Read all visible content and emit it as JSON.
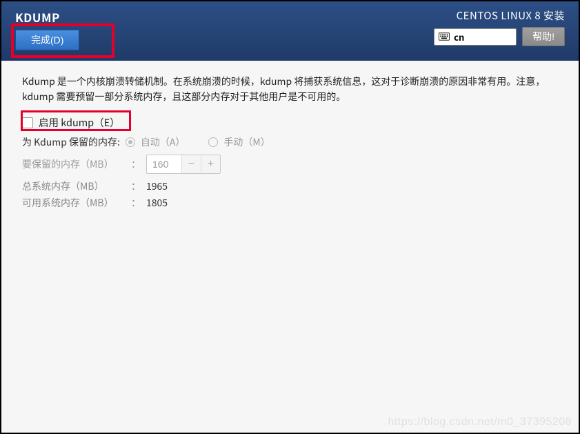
{
  "topbar": {
    "title": "KDUMP",
    "done_label": "完成(D)",
    "install_label": "CENTOS LINUX 8 安装",
    "keyboard_layout": "cn",
    "help_label": "帮助!"
  },
  "content": {
    "description": "Kdump 是一个内核崩溃转储机制。在系统崩溃的时候，kdump 将捕获系统信息，这对于诊断崩溃的原因非常有用。注意，kdump 需要预留一部分系统内存，且这部分内存对于其他用户是不可用的。",
    "enable_label": "启用 kdump（E）",
    "reserve_label": "为 Kdump 保留的内存:",
    "auto_label": "自动（A）",
    "manual_label": "手动（M）",
    "to_reserve_label": "要保留的内存（MB）",
    "to_reserve_value": "160",
    "total_mem_label": "总系统内存（MB）",
    "total_mem_value": "1965",
    "usable_mem_label": "可用系统内存（MB）",
    "usable_mem_value": "1805",
    "colon": "："
  },
  "watermark": "https://blog.csdn.net/m0_37395208"
}
